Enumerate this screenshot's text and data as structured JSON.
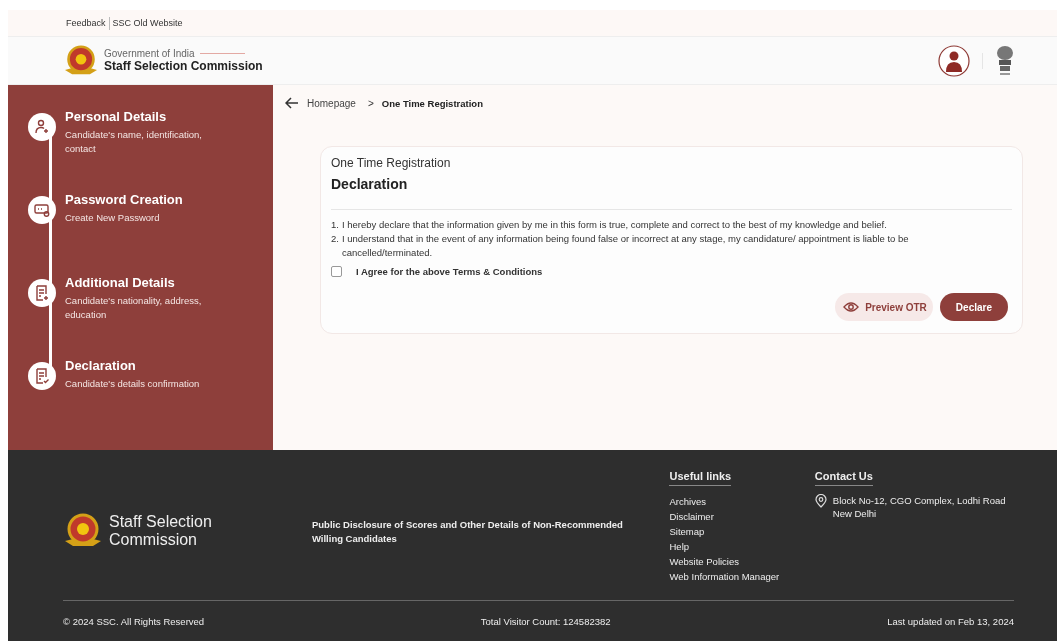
{
  "top_links": [
    "Feedback",
    "SSC Old Website"
  ],
  "header": {
    "subtitle": "Government of India",
    "title": "Staff Selection Commission"
  },
  "steps": [
    {
      "kind": "person",
      "title": "Personal Details",
      "desc": "Candidate's name, identification, contact"
    },
    {
      "kind": "password",
      "title": "Password Creation",
      "desc": "Create New Password"
    },
    {
      "kind": "form",
      "title": "Additional Details",
      "desc": "Candidate's nationality, address, education"
    },
    {
      "kind": "check",
      "title": "Declaration",
      "desc": "Candidate's details confirmation"
    }
  ],
  "breadcrumb": [
    "Homepage",
    ">",
    "One Time Registration"
  ],
  "card": {
    "overline": "One Time Registration",
    "title": "Declaration",
    "points": [
      {
        "number": "1.",
        "text": "I hereby declare that the information given by me in this form is true, complete and correct to the best of my knowledge and belief."
      },
      {
        "number": "2.",
        "text": "I understand that in the event of any information being found false or incorrect at any stage, my candidature/ appointment is liable to be cancelled/terminated."
      }
    ],
    "agree": {
      "label": "I Agree for the above Terms & Conditions",
      "checked": false
    },
    "buttons": [
      {
        "kind": "secondary",
        "label": "Preview OTR"
      },
      {
        "kind": "primary",
        "label": "Declare"
      }
    ]
  },
  "footer": {
    "brand": "Staff Selection Commission",
    "disclosure": "Public Disclosure of Scores and Other Details of Non-Recommended Willing Candidates",
    "useful_links": {
      "title": "Useful links",
      "items": [
        "Archives",
        "Disclaimer",
        "Sitemap",
        "Help",
        "Website Policies",
        "Web Information Manager"
      ]
    },
    "contact": {
      "title": "Contact Us",
      "address": [
        "Block No-12, CGO Complex, Lodhi Road",
        "New Delhi"
      ]
    },
    "copyright": "© 2024 SSC. All Rights Reserved",
    "visitors": "Total Visitor Count: 124582382",
    "updated": "Last updated on Feb 13, 2024"
  }
}
